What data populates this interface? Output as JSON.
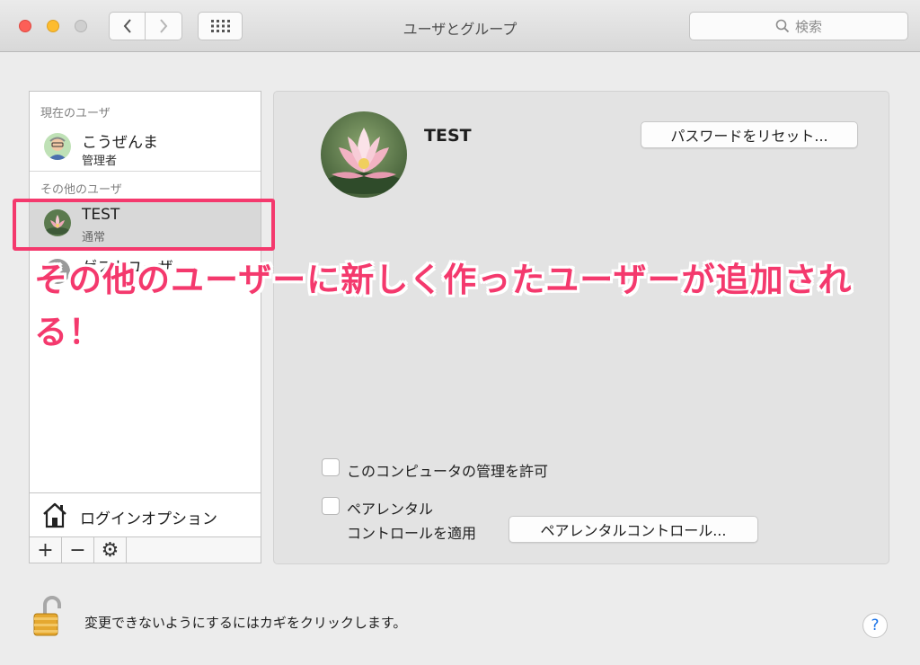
{
  "window": {
    "title": "ユーザとグループ",
    "search_placeholder": "検索"
  },
  "sidebar": {
    "current_header": "現在のユーザ",
    "current_user": {
      "name": "こうぜんま",
      "role": "管理者"
    },
    "other_header": "その他のユーザ",
    "other_users": [
      {
        "name": "TEST",
        "role": "通常"
      },
      {
        "name": "ゲストユーザ",
        "role": ""
      }
    ],
    "login_options_label": "ログインオプション",
    "add_label": "+",
    "remove_label": "−",
    "action_label": "⚙"
  },
  "detail": {
    "user_name": "TEST",
    "reset_password_label": "パスワードをリセット...",
    "allow_admin_label": "このコンピュータの管理を許可",
    "parental_label_line1": "ペアレンタル",
    "parental_label_line2": "コントロールを適用",
    "parental_button_label": "ペアレンタルコントロール..."
  },
  "footer": {
    "lock_text": "変更できないようにするにはカギをクリックします。",
    "help_label": "?"
  },
  "annotation": {
    "text": "その他のユーザーに新しく作ったユーザーが追加される！"
  },
  "colors": {
    "annotation": "#f4396d",
    "selected_row": "#d8d8d8"
  }
}
